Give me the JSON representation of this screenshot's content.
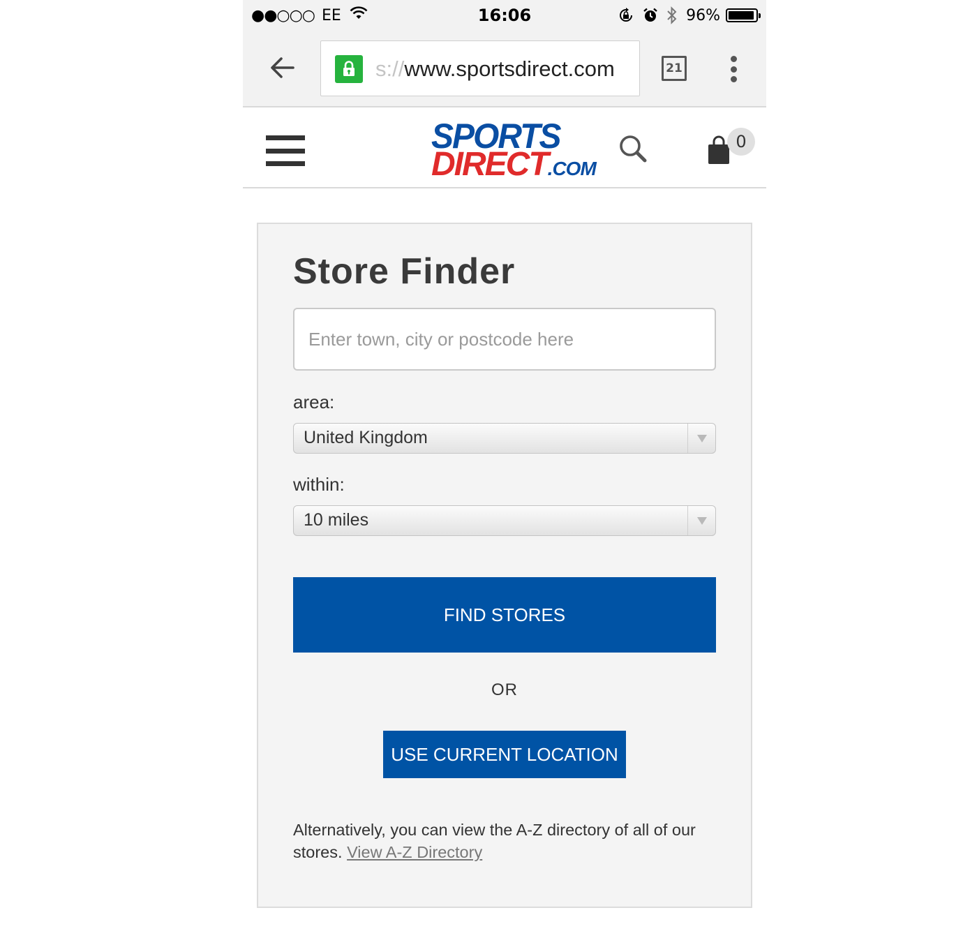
{
  "status_bar": {
    "signal": "●●○○○",
    "carrier": "EE",
    "time": "16:06",
    "battery_percent": "96%",
    "battery_level": 0.96
  },
  "browser": {
    "url_faded": "s://",
    "url_main": "www.sportsdirect.com",
    "tab_count": "21",
    "lock_color": "#26b33e"
  },
  "site_header": {
    "logo_line1": "SPORTS",
    "logo_line2": "DIRECT",
    "logo_suffix": ".COM",
    "cart_count": "0"
  },
  "store_finder": {
    "title": "Store Finder",
    "search_placeholder": "Enter town, city or postcode here",
    "area_label": "area:",
    "area_value": "United Kingdom",
    "within_label": "within:",
    "within_value": "10 miles",
    "find_stores_label": "FIND STORES",
    "or_text": "OR",
    "use_location_label": "USE CURRENT LOCATION",
    "alt_text": "Alternatively, you can view the A-Z directory of all of our stores.",
    "az_link_label": "View A-Z Directory"
  },
  "colors": {
    "primary_button": "#0053a5",
    "logo_blue": "#0a4ea3",
    "logo_red": "#e02b2b",
    "panel_bg": "#f4f4f4"
  }
}
